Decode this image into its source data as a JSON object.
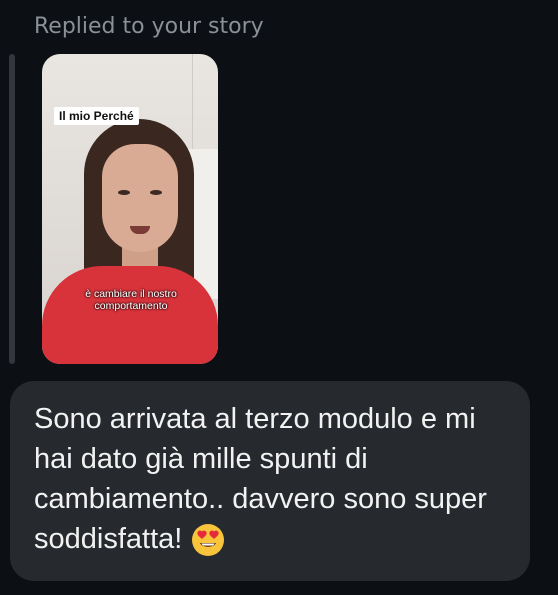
{
  "reply_label": "Replied to your story",
  "story": {
    "caption_title": "Il mio Perché",
    "caption_subtitle": "è cambiare il nostro comportamento"
  },
  "message": {
    "text": "Sono arrivata al terzo modulo e mi hai dato già mille spunti di cambiamento.. davvero sono super soddisfatta!",
    "emoji": "heart-eyes-emoji"
  },
  "colors": {
    "background": "#0c0f14",
    "bubble": "#26292e",
    "label": "#8a8f98",
    "text": "#f2f2f2"
  }
}
